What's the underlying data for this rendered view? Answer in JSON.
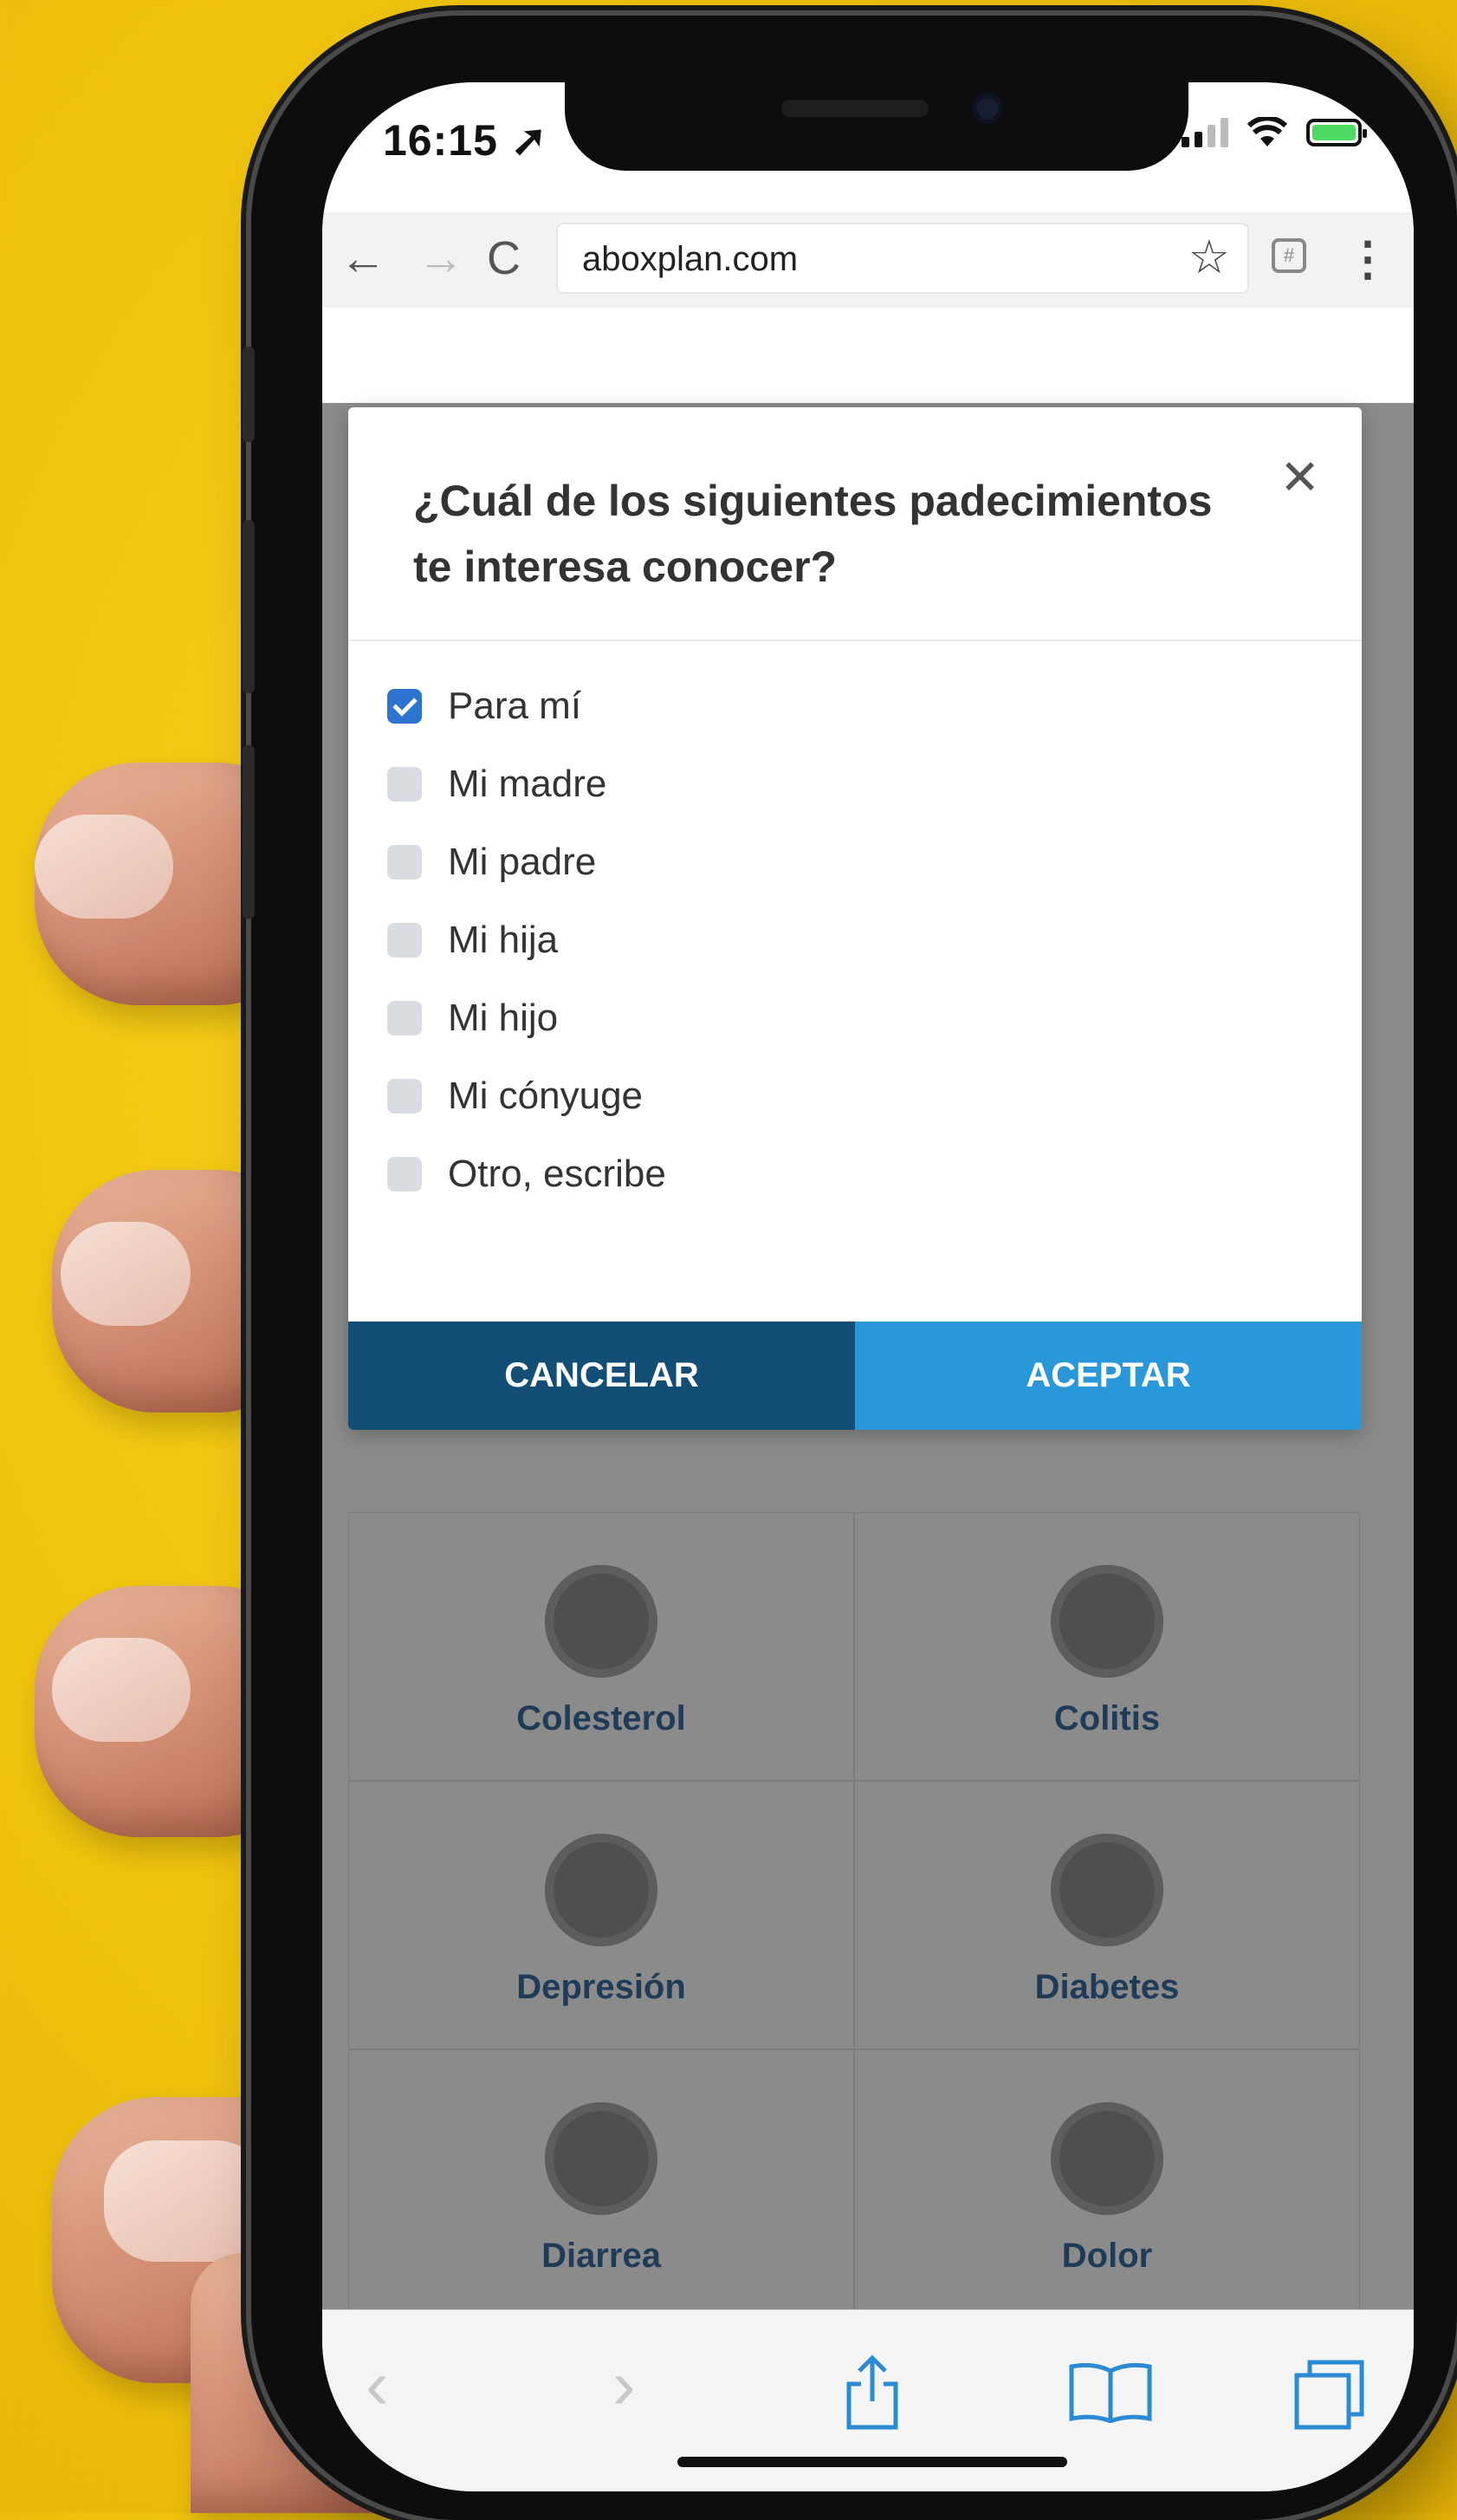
{
  "status_bar": {
    "time": "16:15"
  },
  "browser": {
    "url": "aboxplan.com",
    "back_icon": "arrow-left-icon",
    "forward_icon": "arrow-right-icon",
    "reload_icon": "reload-icon"
  },
  "modal": {
    "title": "¿Cuál de los siguientes padecimientos te interesa conocer?",
    "close_icon": "close-icon",
    "options": [
      {
        "label": "Para mí",
        "checked": true
      },
      {
        "label": "Mi madre",
        "checked": false
      },
      {
        "label": "Mi padre",
        "checked": false
      },
      {
        "label": "Mi hija",
        "checked": false
      },
      {
        "label": "Mi hijo",
        "checked": false
      },
      {
        "label": "Mi cónyuge",
        "checked": false
      },
      {
        "label": "Otro, escribe",
        "checked": false
      }
    ],
    "cancel_label": "CANCELAR",
    "accept_label": "ACEPTAR",
    "colors": {
      "cancel": "#134e76",
      "accept": "#2a97d8",
      "checkbox_checked": "#2d73cf"
    }
  },
  "conditions": [
    {
      "label": "Colesterol",
      "icon": "gauge-icon"
    },
    {
      "label": "Colitis",
      "icon": "intestine-icon"
    },
    {
      "label": "Depresión",
      "icon": "sad-person-icon"
    },
    {
      "label": "Diabetes",
      "icon": "finger-prick-icon"
    },
    {
      "label": "Diarrea",
      "icon": "toilet-icon"
    },
    {
      "label": "Dolor",
      "icon": "pain-person-icon"
    }
  ],
  "toolbar": {
    "icons": [
      "back-icon",
      "forward-icon",
      "share-icon",
      "bookmarks-icon",
      "tabs-icon"
    ]
  },
  "background": {
    "color": "#f0c40e"
  }
}
